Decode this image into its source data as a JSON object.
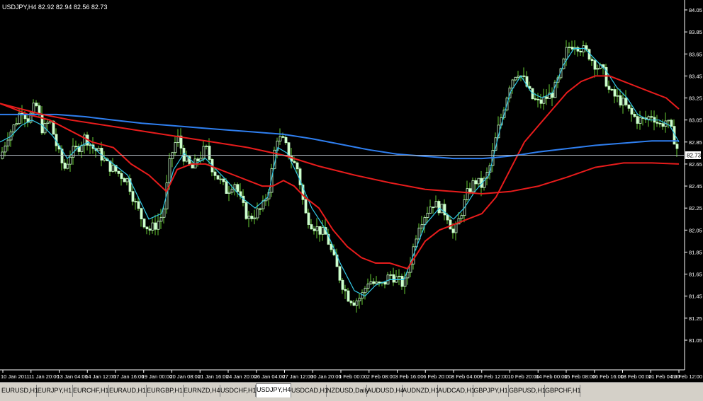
{
  "chart_header": "USDJPY,H4  82.92 82.94 82.56 82.73",
  "current_price_label": "82.73",
  "colors": {
    "background": "#000000",
    "bull_body": "#000000",
    "bull_outline": "#ccffcc",
    "bear_body": "#ccffcc",
    "wick": "#66cc33",
    "ma_fast": "#33c8e6",
    "ma_mid": "#e81c1c",
    "ma_slow": "#2f7ff0",
    "ma_long": "#e81c1c",
    "axis_text": "#ffffff",
    "bid_line": "#b0b8c0"
  },
  "tabs": [
    {
      "label": "EURUSD,H1",
      "active": false
    },
    {
      "label": "EURJPY,H1",
      "active": false
    },
    {
      "label": "EURCHF,H1",
      "active": false
    },
    {
      "label": "EURAUD,H1",
      "active": false
    },
    {
      "label": "EURGBP,H1",
      "active": false
    },
    {
      "label": "EURNZD,H4",
      "active": false
    },
    {
      "label": "USDCHF,H1",
      "active": false
    },
    {
      "label": "USDJPY,H4",
      "active": true
    },
    {
      "label": "USDCAD,H1",
      "active": false
    },
    {
      "label": "NZDUSD,Daily",
      "active": false
    },
    {
      "label": "AUDUSD,H4",
      "active": false
    },
    {
      "label": "AUDNZD,H1",
      "active": false
    },
    {
      "label": "AUDCAD,H1",
      "active": false
    },
    {
      "label": "GBPJPY,H1",
      "active": false
    },
    {
      "label": "GBPUSD,H1",
      "active": false
    },
    {
      "label": "GBPCHF,H1",
      "active": false
    }
  ],
  "chart_data": {
    "type": "candlestick",
    "symbol": "USDJPY",
    "timeframe": "H4",
    "ylim": [
      81.0,
      84.1
    ],
    "y_ticks": [
      "84.05",
      "83.85",
      "83.65",
      "83.45",
      "83.25",
      "83.05",
      "82.85",
      "82.65",
      "82.45",
      "82.25",
      "82.05",
      "81.85",
      "81.65",
      "81.45",
      "81.25",
      "81.05"
    ],
    "x_ticks": [
      "10 Jan 2011",
      "11 Jan 20:00",
      "13 Jan 04:00",
      "14 Jan 12:00",
      "17 Jan 16:00",
      "19 Jan 00:00",
      "20 Jan 08:00",
      "21 Jan 16:00",
      "24 Jan 20:00",
      "26 Jan 04:00",
      "27 Jan 12:00",
      "30 Jan 20:00",
      "1 Feb 00:00",
      "2 Feb 08:00",
      "3 Feb 16:00",
      "6 Feb 20:00",
      "8 Feb 04:00",
      "9 Feb 12:00",
      "10 Feb 20:00",
      "14 Feb 00:00",
      "15 Feb 08:00",
      "16 Feb 16:00",
      "18 Feb 00:00",
      "21 Feb 04:00",
      "22 Feb 12:00"
    ],
    "current_price": 82.73,
    "close_path": [
      [
        0,
        82.7
      ],
      [
        10,
        82.9
      ],
      [
        20,
        83.0
      ],
      [
        30,
        83.15
      ],
      [
        40,
        83.05
      ],
      [
        50,
        83.2
      ],
      [
        60,
        82.95
      ],
      [
        70,
        83.05
      ],
      [
        80,
        82.8
      ],
      [
        90,
        82.6
      ],
      [
        100,
        82.75
      ],
      [
        110,
        82.8
      ],
      [
        120,
        82.9
      ],
      [
        130,
        82.8
      ],
      [
        140,
        82.75
      ],
      [
        150,
        82.65
      ],
      [
        160,
        82.6
      ],
      [
        170,
        82.55
      ],
      [
        180,
        82.5
      ],
      [
        190,
        82.3
      ],
      [
        200,
        82.15
      ],
      [
        210,
        82.05
      ],
      [
        220,
        82.1
      ],
      [
        230,
        82.2
      ],
      [
        240,
        82.7
      ],
      [
        250,
        82.9
      ],
      [
        260,
        82.7
      ],
      [
        270,
        82.6
      ],
      [
        280,
        82.7
      ],
      [
        290,
        82.8
      ],
      [
        300,
        82.6
      ],
      [
        310,
        82.5
      ],
      [
        320,
        82.4
      ],
      [
        330,
        82.5
      ],
      [
        340,
        82.3
      ],
      [
        350,
        82.15
      ],
      [
        360,
        82.2
      ],
      [
        370,
        82.25
      ],
      [
        380,
        82.45
      ],
      [
        390,
        82.9
      ],
      [
        400,
        82.85
      ],
      [
        410,
        82.7
      ],
      [
        420,
        82.6
      ],
      [
        430,
        82.2
      ],
      [
        440,
        82.1
      ],
      [
        450,
        82.05
      ],
      [
        460,
        82.0
      ],
      [
        470,
        81.8
      ],
      [
        480,
        81.6
      ],
      [
        490,
        81.45
      ],
      [
        500,
        81.4
      ],
      [
        510,
        81.45
      ],
      [
        520,
        81.6
      ],
      [
        530,
        81.55
      ],
      [
        540,
        81.55
      ],
      [
        550,
        81.65
      ],
      [
        560,
        81.6
      ],
      [
        570,
        81.55
      ],
      [
        580,
        81.8
      ],
      [
        590,
        82.1
      ],
      [
        600,
        82.2
      ],
      [
        610,
        82.3
      ],
      [
        620,
        82.25
      ],
      [
        630,
        82.2
      ],
      [
        640,
        82.0
      ],
      [
        650,
        82.2
      ],
      [
        660,
        82.4
      ],
      [
        670,
        82.5
      ],
      [
        680,
        82.45
      ],
      [
        690,
        82.6
      ],
      [
        700,
        82.9
      ],
      [
        710,
        83.15
      ],
      [
        720,
        83.4
      ],
      [
        730,
        83.5
      ],
      [
        740,
        83.4
      ],
      [
        750,
        83.25
      ],
      [
        760,
        83.2
      ],
      [
        770,
        83.25
      ],
      [
        780,
        83.3
      ],
      [
        790,
        83.45
      ],
      [
        800,
        83.7
      ],
      [
        810,
        83.75
      ],
      [
        820,
        83.7
      ],
      [
        830,
        83.65
      ],
      [
        840,
        83.55
      ],
      [
        850,
        83.5
      ],
      [
        860,
        83.3
      ],
      [
        870,
        83.25
      ],
      [
        880,
        83.2
      ],
      [
        890,
        83.1
      ],
      [
        900,
        83.05
      ],
      [
        910,
        83.05
      ],
      [
        920,
        83.1
      ],
      [
        930,
        83.0
      ],
      [
        940,
        83.05
      ],
      [
        950,
        82.9
      ],
      [
        958,
        82.73
      ]
    ],
    "series": [
      {
        "key": "ma_fast",
        "values": [
          [
            0,
            82.85
          ],
          [
            15,
            82.9
          ],
          [
            30,
            83.0
          ],
          [
            45,
            83.05
          ],
          [
            60,
            83.0
          ],
          [
            75,
            82.9
          ],
          [
            95,
            82.7
          ],
          [
            110,
            82.8
          ],
          [
            125,
            82.85
          ],
          [
            140,
            82.75
          ],
          [
            160,
            82.65
          ],
          [
            180,
            82.55
          ],
          [
            195,
            82.35
          ],
          [
            210,
            82.15
          ],
          [
            228,
            82.2
          ],
          [
            245,
            82.6
          ],
          [
            260,
            82.75
          ],
          [
            275,
            82.65
          ],
          [
            290,
            82.7
          ],
          [
            305,
            82.6
          ],
          [
            320,
            82.5
          ],
          [
            340,
            82.35
          ],
          [
            360,
            82.25
          ],
          [
            378,
            82.35
          ],
          [
            392,
            82.8
          ],
          [
            405,
            82.75
          ],
          [
            420,
            82.55
          ],
          [
            440,
            82.25
          ],
          [
            460,
            82.05
          ],
          [
            480,
            81.75
          ],
          [
            500,
            81.5
          ],
          [
            515,
            81.45
          ],
          [
            530,
            81.55
          ],
          [
            550,
            81.6
          ],
          [
            570,
            81.6
          ],
          [
            585,
            81.85
          ],
          [
            600,
            82.1
          ],
          [
            620,
            82.25
          ],
          [
            640,
            82.15
          ],
          [
            655,
            82.25
          ],
          [
            670,
            82.4
          ],
          [
            690,
            82.55
          ],
          [
            705,
            82.95
          ],
          [
            720,
            83.3
          ],
          [
            735,
            83.45
          ],
          [
            750,
            83.3
          ],
          [
            765,
            83.25
          ],
          [
            780,
            83.3
          ],
          [
            795,
            83.55
          ],
          [
            810,
            83.7
          ],
          [
            825,
            83.7
          ],
          [
            840,
            83.6
          ],
          [
            855,
            83.5
          ],
          [
            870,
            83.35
          ],
          [
            885,
            83.25
          ],
          [
            900,
            83.1
          ],
          [
            915,
            83.05
          ],
          [
            930,
            83.05
          ],
          [
            945,
            83.0
          ],
          [
            958,
            82.85
          ]
        ]
      },
      {
        "key": "ma_mid",
        "values": [
          [
            0,
            83.2
          ],
          [
            20,
            83.15
          ],
          [
            40,
            83.1
          ],
          [
            70,
            83.05
          ],
          [
            100,
            82.95
          ],
          [
            130,
            82.85
          ],
          [
            160,
            82.8
          ],
          [
            185,
            82.65
          ],
          [
            210,
            82.55
          ],
          [
            235,
            82.4
          ],
          [
            250,
            82.6
          ],
          [
            270,
            82.65
          ],
          [
            290,
            82.65
          ],
          [
            310,
            82.6
          ],
          [
            330,
            82.55
          ],
          [
            350,
            82.5
          ],
          [
            370,
            82.45
          ],
          [
            385,
            82.45
          ],
          [
            400,
            82.5
          ],
          [
            415,
            82.45
          ],
          [
            430,
            82.35
          ],
          [
            450,
            82.25
          ],
          [
            470,
            82.05
          ],
          [
            490,
            81.9
          ],
          [
            510,
            81.8
          ],
          [
            530,
            81.75
          ],
          [
            550,
            81.75
          ],
          [
            575,
            81.7
          ],
          [
            585,
            81.8
          ],
          [
            600,
            81.95
          ],
          [
            620,
            82.05
          ],
          [
            640,
            82.1
          ],
          [
            660,
            82.15
          ],
          [
            680,
            82.2
          ],
          [
            700,
            82.35
          ],
          [
            720,
            82.6
          ],
          [
            740,
            82.85
          ],
          [
            760,
            83.0
          ],
          [
            780,
            83.15
          ],
          [
            800,
            83.3
          ],
          [
            820,
            83.4
          ],
          [
            840,
            83.45
          ],
          [
            860,
            83.45
          ],
          [
            880,
            83.4
          ],
          [
            900,
            83.35
          ],
          [
            920,
            83.3
          ],
          [
            940,
            83.25
          ],
          [
            958,
            83.15
          ]
        ]
      },
      {
        "key": "ma_slow",
        "values": [
          [
            0,
            83.1
          ],
          [
            40,
            83.1
          ],
          [
            80,
            83.1
          ],
          [
            120,
            83.08
          ],
          [
            160,
            83.05
          ],
          [
            200,
            83.02
          ],
          [
            240,
            83.0
          ],
          [
            280,
            82.98
          ],
          [
            320,
            82.96
          ],
          [
            360,
            82.94
          ],
          [
            400,
            82.92
          ],
          [
            440,
            82.88
          ],
          [
            480,
            82.83
          ],
          [
            520,
            82.78
          ],
          [
            560,
            82.74
          ],
          [
            600,
            82.72
          ],
          [
            640,
            82.7
          ],
          [
            680,
            82.7
          ],
          [
            700,
            82.71
          ],
          [
            730,
            82.73
          ],
          [
            760,
            82.76
          ],
          [
            800,
            82.79
          ],
          [
            840,
            82.82
          ],
          [
            880,
            82.84
          ],
          [
            920,
            82.86
          ],
          [
            958,
            82.86
          ]
        ]
      },
      {
        "key": "ma_long",
        "values": [
          [
            0,
            83.2
          ],
          [
            30,
            83.15
          ],
          [
            60,
            83.1
          ],
          [
            100,
            83.05
          ],
          [
            150,
            83.0
          ],
          [
            200,
            82.95
          ],
          [
            250,
            82.9
          ],
          [
            300,
            82.85
          ],
          [
            350,
            82.8
          ],
          [
            400,
            82.73
          ],
          [
            450,
            82.63
          ],
          [
            500,
            82.55
          ],
          [
            550,
            82.48
          ],
          [
            600,
            82.42
          ],
          [
            640,
            82.4
          ],
          [
            680,
            82.38
          ],
          [
            720,
            82.4
          ],
          [
            760,
            82.45
          ],
          [
            800,
            82.53
          ],
          [
            840,
            82.62
          ],
          [
            880,
            82.66
          ],
          [
            920,
            82.66
          ],
          [
            958,
            82.65
          ]
        ]
      }
    ]
  }
}
